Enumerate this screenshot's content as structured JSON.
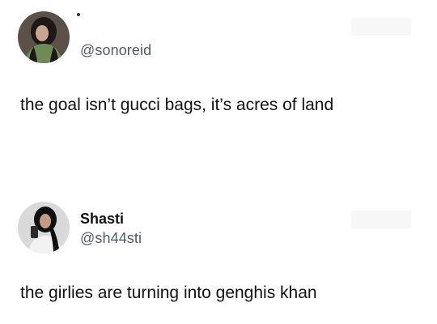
{
  "posts": [
    {
      "display_name": "",
      "handle": "@sonoreid",
      "text": "the goal isn’t gucci bags, it’s acres of land"
    },
    {
      "display_name": "Shasti",
      "handle": "@sh44sti",
      "text": "the girlies are turning into genghis khan"
    }
  ],
  "colors": {
    "background": "#ffffff",
    "text": "#111111",
    "handle": "#4f5b66"
  }
}
